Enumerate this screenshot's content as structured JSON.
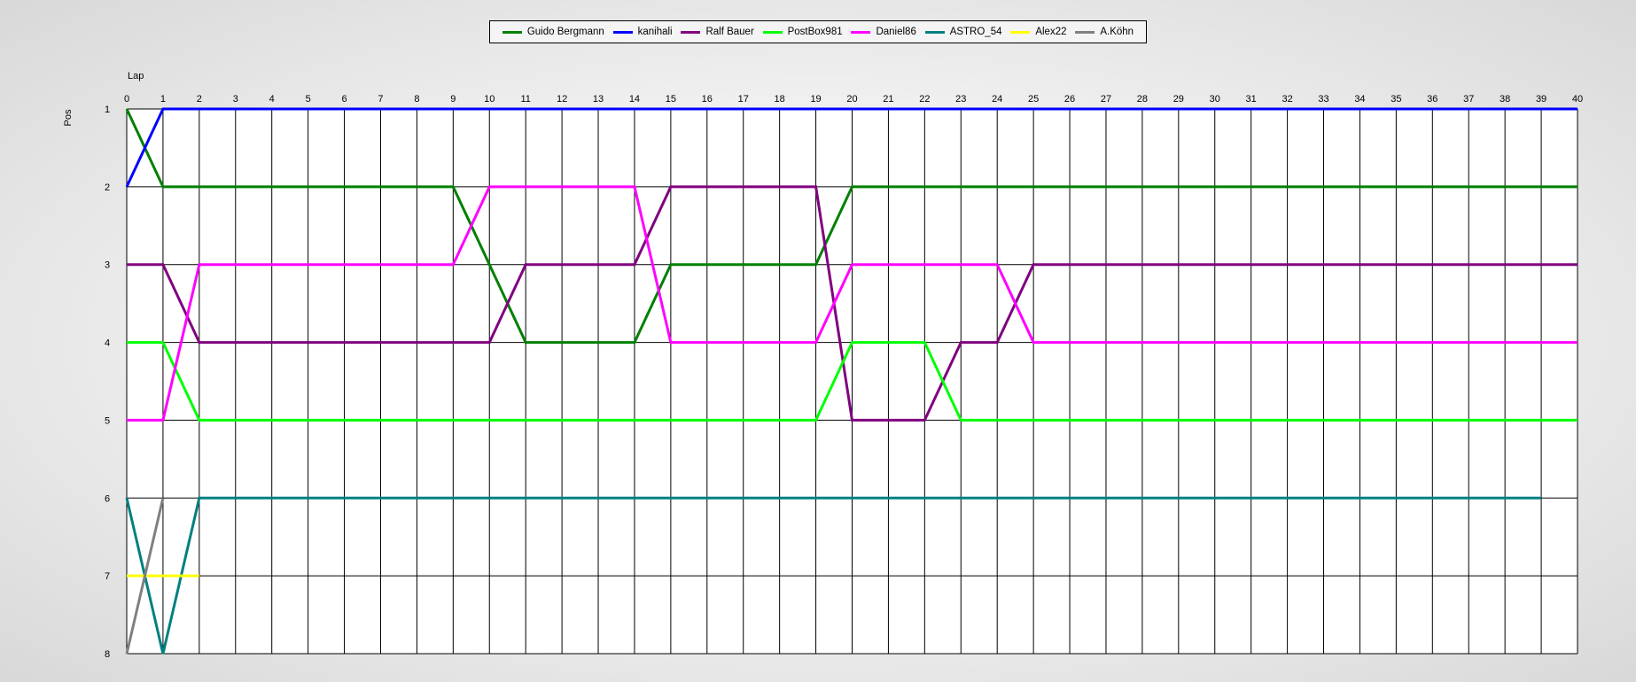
{
  "chart_data": {
    "type": "line",
    "title": "",
    "xlabel": "Lap",
    "ylabel": "Pos",
    "xlim": [
      0,
      40
    ],
    "ylim": [
      1,
      8
    ],
    "y_inverted": true,
    "grid": true,
    "legend_position": "top-center",
    "x_ticks": [
      0,
      1,
      2,
      3,
      4,
      5,
      6,
      7,
      8,
      9,
      10,
      11,
      12,
      13,
      14,
      15,
      16,
      17,
      18,
      19,
      20,
      21,
      22,
      23,
      24,
      25,
      26,
      27,
      28,
      29,
      30,
      31,
      32,
      33,
      34,
      35,
      36,
      37,
      38,
      39,
      40
    ],
    "y_ticks": [
      1,
      2,
      3,
      4,
      5,
      6,
      7,
      8
    ],
    "series": [
      {
        "name": "Guido Bergmann",
        "color": "#008000",
        "values": [
          1,
          2,
          2,
          2,
          2,
          2,
          2,
          2,
          2,
          2,
          3,
          4,
          4,
          4,
          4,
          3,
          3,
          3,
          3,
          3,
          2,
          2,
          2,
          2,
          2,
          2,
          2,
          2,
          2,
          2,
          2,
          2,
          2,
          2,
          2,
          2,
          2,
          2,
          2,
          2,
          2
        ]
      },
      {
        "name": "kanihali",
        "color": "#0000ff",
        "values": [
          2,
          1,
          1,
          1,
          1,
          1,
          1,
          1,
          1,
          1,
          1,
          1,
          1,
          1,
          1,
          1,
          1,
          1,
          1,
          1,
          1,
          1,
          1,
          1,
          1,
          1,
          1,
          1,
          1,
          1,
          1,
          1,
          1,
          1,
          1,
          1,
          1,
          1,
          1,
          1,
          1
        ]
      },
      {
        "name": "Ralf Bauer",
        "color": "#800080",
        "values": [
          3,
          3,
          4,
          4,
          4,
          4,
          4,
          4,
          4,
          4,
          4,
          3,
          3,
          3,
          3,
          2,
          2,
          2,
          2,
          2,
          5,
          5,
          5,
          4,
          4,
          3,
          3,
          3,
          3,
          3,
          3,
          3,
          3,
          3,
          3,
          3,
          3,
          3,
          3,
          3,
          3
        ]
      },
      {
        "name": "PostBox981",
        "color": "#00ff00",
        "values": [
          4,
          4,
          5,
          5,
          5,
          5,
          5,
          5,
          5,
          5,
          5,
          5,
          5,
          5,
          5,
          5,
          5,
          5,
          5,
          5,
          4,
          4,
          4,
          5,
          5,
          5,
          5,
          5,
          5,
          5,
          5,
          5,
          5,
          5,
          5,
          5,
          5,
          5,
          5,
          5,
          5
        ]
      },
      {
        "name": "Daniel86",
        "color": "#ff00ff",
        "values": [
          5,
          5,
          3,
          3,
          3,
          3,
          3,
          3,
          3,
          3,
          2,
          2,
          2,
          2,
          2,
          4,
          4,
          4,
          4,
          4,
          3,
          3,
          3,
          3,
          3,
          4,
          4,
          4,
          4,
          4,
          4,
          4,
          4,
          4,
          4,
          4,
          4,
          4,
          4,
          4,
          4
        ]
      },
      {
        "name": "ASTRO_54",
        "color": "#008080",
        "values": [
          6,
          8,
          6,
          6,
          6,
          6,
          6,
          6,
          6,
          6,
          6,
          6,
          6,
          6,
          6,
          6,
          6,
          6,
          6,
          6,
          6,
          6,
          6,
          6,
          6,
          6,
          6,
          6,
          6,
          6,
          6,
          6,
          6,
          6,
          6,
          6,
          6,
          6,
          6,
          6
        ]
      },
      {
        "name": "Alex22",
        "color": "#ffff00",
        "values": [
          7,
          7,
          7
        ]
      },
      {
        "name": "A.Köhn",
        "color": "#808080",
        "values": [
          8,
          6
        ]
      }
    ]
  }
}
